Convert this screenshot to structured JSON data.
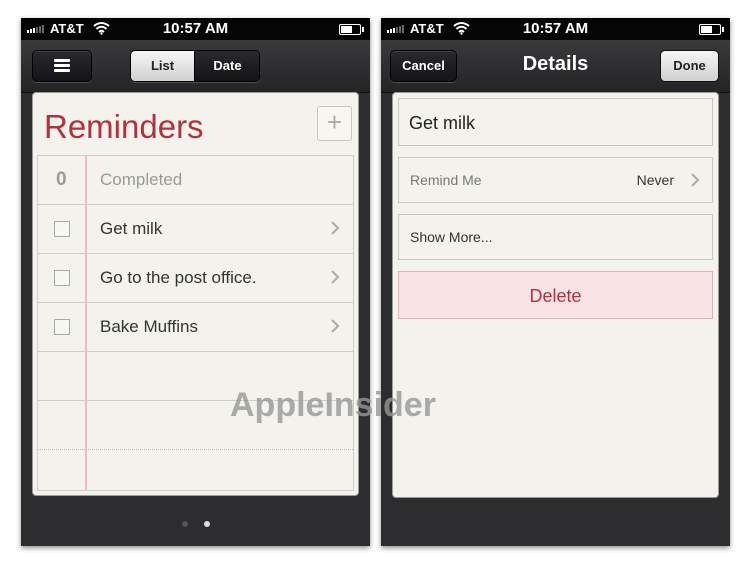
{
  "status_bar": {
    "carrier": "AT&T",
    "time": "10:57 AM"
  },
  "left_screen": {
    "segmented": {
      "list_label": "List",
      "date_label": "Date"
    },
    "title": "Reminders",
    "add_label": "+",
    "completed": {
      "count": "0",
      "label": "Completed"
    },
    "items": [
      {
        "label": "Get milk"
      },
      {
        "label": "Go to the post office."
      },
      {
        "label": "Bake Muffins"
      }
    ],
    "page_dots": 2,
    "active_page": 2
  },
  "right_screen": {
    "nav": {
      "cancel_label": "Cancel",
      "title": "Details",
      "done_label": "Done"
    },
    "reminder_title": "Get milk",
    "remind_me": {
      "label": "Remind Me",
      "value": "Never"
    },
    "show_more_label": "Show More...",
    "delete_label": "Delete"
  },
  "watermark": "AppleInsider",
  "colors": {
    "accent_red": "#b0323f",
    "delete_bg": "#f9e3e5",
    "margin_line": "#f2b9bf"
  },
  "icons": [
    "hamburger-menu-icon",
    "add-icon",
    "chevron-right-icon",
    "wifi-icon",
    "battery-icon",
    "signal-bars-icon"
  ]
}
